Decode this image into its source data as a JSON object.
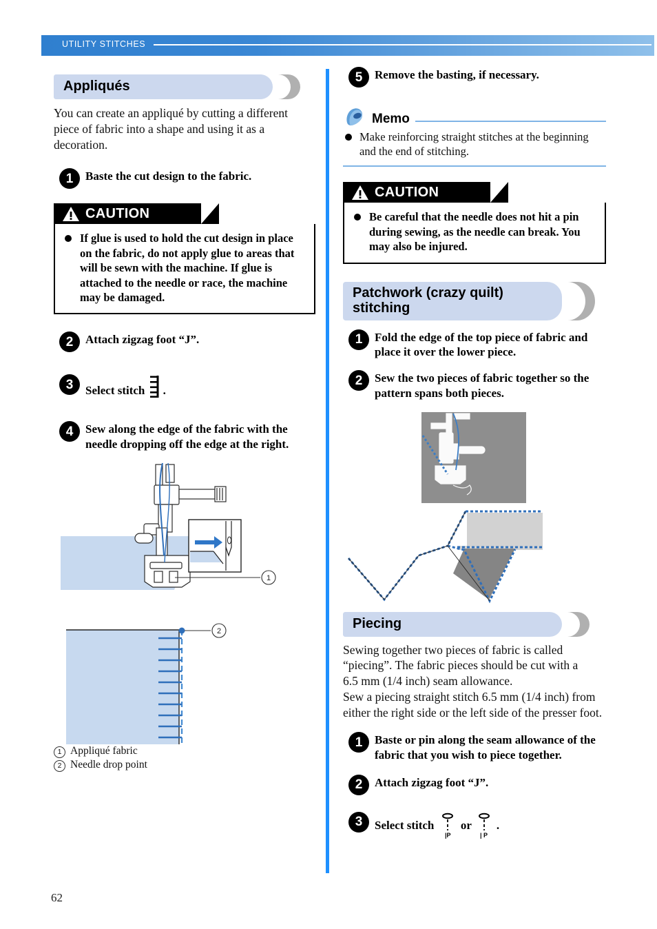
{
  "running_header": {
    "label": "UTILITY STITCHES"
  },
  "page_number": "62",
  "colors": {
    "header_blue": "#3a87d4",
    "divider_blue": "#1e90ff",
    "section_bar": "#ccd8ee",
    "memo_rule": "#7fb4e6",
    "fabric_light": "#c7d9ef",
    "fabric_gray": "#8a8a8a",
    "stitch_blue": "#2f6fba",
    "arrow_blue": "#2f77c8"
  },
  "left_column": {
    "section": {
      "title": "Appliqués"
    },
    "intro": "You can create an appliqué by cutting a different piece of fabric into a shape and using it as a decoration.",
    "steps": [
      {
        "num": "1",
        "text": "Baste the cut design to the fabric."
      },
      {
        "num": "2",
        "text": "Attach zigzag foot “J”."
      },
      {
        "num": "3",
        "text_before": "Select stitch",
        "icon": "blanket-stitch-icon",
        "text_after": "."
      },
      {
        "num": "4",
        "text": "Sew along the edge of the fabric with the needle dropping off the edge at the right."
      }
    ],
    "caution": {
      "title": "CAUTION",
      "icon": "warning-triangle-icon",
      "items": [
        "If glue is used to hold the cut design in place on the fabric, do not apply glue to areas that will be sewn with the machine. If glue is attached to the needle or race, the machine may be damaged."
      ]
    },
    "figure_presser_foot": {
      "name": "presser-foot-applique-figure",
      "callout_number": "1",
      "inset": {
        "name": "needle-drop-inset",
        "arrow": "right-arrow-icon"
      }
    },
    "figure_edge": {
      "name": "applique-edge-stitch-figure",
      "callout_number": "2"
    },
    "captions": [
      {
        "marker": "1",
        "text": "Appliqué fabric"
      },
      {
        "marker": "2",
        "text": "Needle drop point"
      }
    ]
  },
  "right_column": {
    "step5": {
      "num": "5",
      "text": "Remove the basting, if necessary."
    },
    "memo": {
      "title": "Memo",
      "icon": "memo-bell-icon",
      "items": [
        "Make reinforcing straight stitches at the beginning and the end of stitching."
      ]
    },
    "caution": {
      "title": "CAUTION",
      "icon": "warning-triangle-icon",
      "items": [
        "Be careful that the needle does not hit a pin during sewing, as the needle can break. You may also be injured."
      ]
    },
    "patchwork": {
      "section": {
        "title_line1": "Patchwork (crazy quilt)",
        "title_line2": "stitching"
      },
      "steps": [
        {
          "num": "1",
          "text": "Fold the edge of the top piece of fabric and place it over the lower piece."
        },
        {
          "num": "2",
          "text": "Sew the two pieces of fabric together so the pattern spans both pieces."
        }
      ],
      "figure": {
        "name": "patchwork-stitching-figure"
      }
    },
    "piecing": {
      "section": {
        "title": "Piecing"
      },
      "intro_line1": "Sewing together two pieces of fabric is called",
      "intro_line2": "“piecing”. The fabric pieces should be cut with a",
      "intro_line3": "6.5 mm (1/4 inch) seam allowance.",
      "intro_line4": "Sew a piecing straight stitch 6.5 mm (1/4 inch) from",
      "intro_line5": "either the right side or the left side of the presser foot.",
      "steps": [
        {
          "num": "1",
          "text": "Baste or pin along the seam allowance of the fabric that you wish to piece together."
        },
        {
          "num": "2",
          "text": "Attach zigzag foot “J”."
        },
        {
          "num": "3",
          "text_before": "Select stitch",
          "icon_left": "piecing-stitch-left-icon",
          "icon_left_label": "|P",
          "conjunction": "or",
          "icon_right": "piecing-stitch-right-icon",
          "icon_right_label": "| P",
          "text_after": "."
        }
      ]
    }
  }
}
